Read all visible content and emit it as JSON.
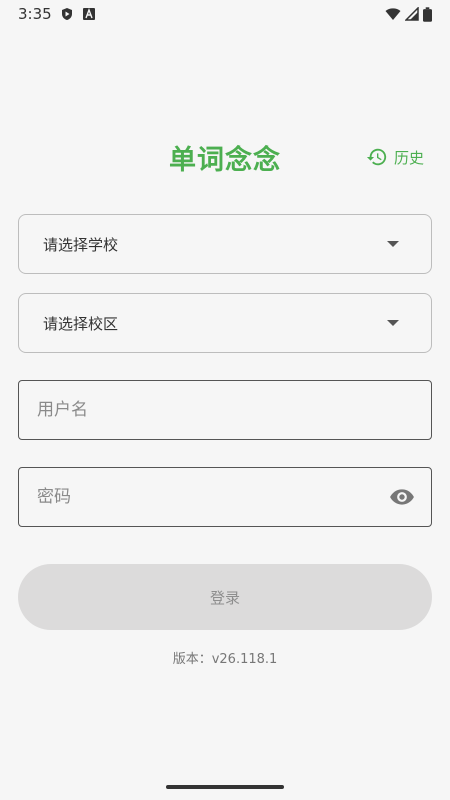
{
  "status_bar": {
    "time": "3:35",
    "icons": [
      "shield-play-icon",
      "font-a-icon",
      "wifi-icon",
      "signal-icon",
      "battery-icon"
    ]
  },
  "app": {
    "title": "单词念念",
    "history_label": "历史"
  },
  "form": {
    "school_select": {
      "value": "请选择学校"
    },
    "campus_select": {
      "value": "请选择校区"
    },
    "username": {
      "placeholder": "用户名",
      "value": ""
    },
    "password": {
      "placeholder": "密码",
      "value": ""
    },
    "login_label": "登录"
  },
  "footer": {
    "version": "版本：v26.118.1"
  },
  "colors": {
    "accent": "#4caf50",
    "background": "#f6f6f6",
    "button_disabled": "#dcdbdb"
  }
}
